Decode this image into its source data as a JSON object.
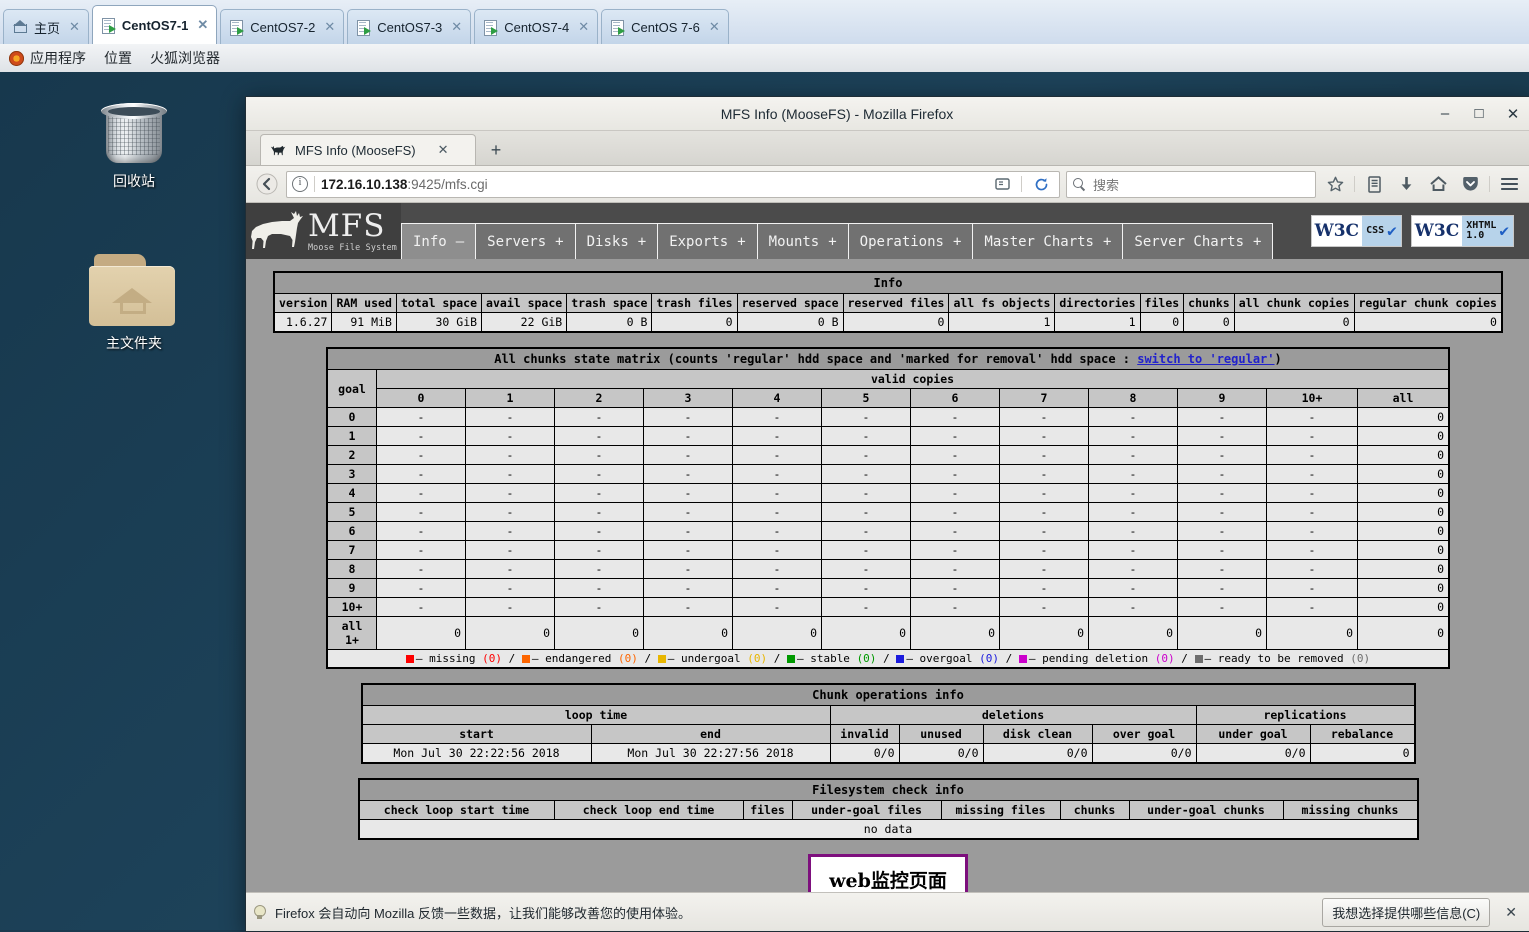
{
  "vm_tabs": [
    {
      "label": "主页",
      "icon": "home-icon",
      "active": false
    },
    {
      "label": "CentOS7-1",
      "icon": "vm-icon",
      "active": true
    },
    {
      "label": "CentOS7-2",
      "icon": "vm-icon",
      "active": false
    },
    {
      "label": "CentOS7-3",
      "icon": "vm-icon",
      "active": false
    },
    {
      "label": "CentOS7-4",
      "icon": "vm-icon",
      "active": false
    },
    {
      "label": "CentOS 7-6",
      "icon": "vm-icon",
      "active": false
    }
  ],
  "gnome_menu": [
    "应用程序",
    "位置",
    "火狐浏览器"
  ],
  "desktop_icons": [
    {
      "label": "回收站",
      "icon": "trash-icon"
    },
    {
      "label": "主文件夹",
      "icon": "home-folder-icon"
    }
  ],
  "browser": {
    "window_title": "MFS Info (MooseFS) - Mozilla Firefox",
    "minimize": "–",
    "maximize": "□",
    "close": "✕",
    "tab_title": "MFS Info (MooseFS)",
    "tab_close": "✕",
    "new_tab": "+",
    "url_host": "172.16.10.138",
    "url_rest": ":9425/mfs.cgi",
    "search_placeholder": "搜索"
  },
  "mfs": {
    "logo_title": "MFS",
    "logo_subtitle": "Moose File System",
    "nav": [
      {
        "label": "Info",
        "sign": "–",
        "selected": true
      },
      {
        "label": "Servers",
        "sign": "+",
        "selected": false
      },
      {
        "label": "Disks",
        "sign": "+",
        "selected": false
      },
      {
        "label": "Exports",
        "sign": "+",
        "selected": false
      },
      {
        "label": "Mounts",
        "sign": "+",
        "selected": false
      },
      {
        "label": "Operations",
        "sign": "+",
        "selected": false
      },
      {
        "label": "Master Charts",
        "sign": "+",
        "selected": false
      },
      {
        "label": "Server Charts",
        "sign": "+",
        "selected": false
      }
    ],
    "badges": [
      {
        "left": "W3C",
        "line1": "CSS",
        "line2": ""
      },
      {
        "left": "W3C",
        "line1": "XHTML",
        "line2": "1.0"
      }
    ],
    "info": {
      "caption": "Info",
      "headers": [
        "version",
        "RAM used",
        "total space",
        "avail space",
        "trash space",
        "trash files",
        "reserved space",
        "reserved files",
        "all fs objects",
        "directories",
        "files",
        "chunks",
        "all chunk copies",
        "regular chunk copies"
      ],
      "values": [
        "1.6.27",
        "91 MiB",
        "30 GiB",
        "22 GiB",
        "0 B",
        "0",
        "0 B",
        "0",
        "1",
        "1",
        "0",
        "0",
        "0",
        "0"
      ]
    },
    "matrix": {
      "caption_pre": "All chunks state matrix (counts 'regular' hdd space and 'marked for removal' hdd space : ",
      "caption_link": "switch to 'regular'",
      "caption_post": ")",
      "goal_label": "goal",
      "valid_copies_label": "valid copies",
      "columns": [
        "0",
        "1",
        "2",
        "3",
        "4",
        "5",
        "6",
        "7",
        "8",
        "9",
        "10+",
        "all"
      ],
      "rows": [
        {
          "goal": "0",
          "cells": [
            "-",
            "-",
            "-",
            "-",
            "-",
            "-",
            "-",
            "-",
            "-",
            "-",
            "-"
          ],
          "all": "0"
        },
        {
          "goal": "1",
          "cells": [
            "-",
            "-",
            "-",
            "-",
            "-",
            "-",
            "-",
            "-",
            "-",
            "-",
            "-"
          ],
          "all": "0"
        },
        {
          "goal": "2",
          "cells": [
            "-",
            "-",
            "-",
            "-",
            "-",
            "-",
            "-",
            "-",
            "-",
            "-",
            "-"
          ],
          "all": "0"
        },
        {
          "goal": "3",
          "cells": [
            "-",
            "-",
            "-",
            "-",
            "-",
            "-",
            "-",
            "-",
            "-",
            "-",
            "-"
          ],
          "all": "0"
        },
        {
          "goal": "4",
          "cells": [
            "-",
            "-",
            "-",
            "-",
            "-",
            "-",
            "-",
            "-",
            "-",
            "-",
            "-"
          ],
          "all": "0"
        },
        {
          "goal": "5",
          "cells": [
            "-",
            "-",
            "-",
            "-",
            "-",
            "-",
            "-",
            "-",
            "-",
            "-",
            "-"
          ],
          "all": "0"
        },
        {
          "goal": "6",
          "cells": [
            "-",
            "-",
            "-",
            "-",
            "-",
            "-",
            "-",
            "-",
            "-",
            "-",
            "-"
          ],
          "all": "0"
        },
        {
          "goal": "7",
          "cells": [
            "-",
            "-",
            "-",
            "-",
            "-",
            "-",
            "-",
            "-",
            "-",
            "-",
            "-"
          ],
          "all": "0"
        },
        {
          "goal": "8",
          "cells": [
            "-",
            "-",
            "-",
            "-",
            "-",
            "-",
            "-",
            "-",
            "-",
            "-",
            "-"
          ],
          "all": "0"
        },
        {
          "goal": "9",
          "cells": [
            "-",
            "-",
            "-",
            "-",
            "-",
            "-",
            "-",
            "-",
            "-",
            "-",
            "-"
          ],
          "all": "0"
        },
        {
          "goal": "10+",
          "cells": [
            "-",
            "-",
            "-",
            "-",
            "-",
            "-",
            "-",
            "-",
            "-",
            "-",
            "-"
          ],
          "all": "0"
        }
      ],
      "total_row": {
        "goal": "all 1+",
        "cells": [
          "0",
          "0",
          "0",
          "0",
          "0",
          "0",
          "0",
          "0",
          "0",
          "0",
          "0"
        ],
        "all": "0"
      },
      "legend": [
        {
          "color": "#fe0000",
          "label": "missing",
          "count": "(0)",
          "count_color": "#fe0000"
        },
        {
          "color": "#fd6500",
          "label": "endangered",
          "count": "(0)",
          "count_color": "#fd6500"
        },
        {
          "color": "#e8b600",
          "label": "undergoal",
          "count": "(0)",
          "count_color": "#e8b600"
        },
        {
          "color": "#009900",
          "label": "stable",
          "count": "(0)",
          "count_color": "#009900"
        },
        {
          "color": "#1b1bdd",
          "label": "overgoal",
          "count": "(0)",
          "count_color": "#1b1bdd"
        },
        {
          "color": "#cc00cc",
          "label": "pending deletion",
          "count": "(0)",
          "count_color": "#cc00cc"
        },
        {
          "color": "#6e6e6e",
          "label": "ready to be removed",
          "count": "(0)",
          "count_color": "#6e6e6e"
        }
      ],
      "legend_sep": "/"
    },
    "chunkops": {
      "caption": "Chunk operations info",
      "groups": [
        {
          "label": "loop time",
          "span": 2
        },
        {
          "label": "deletions",
          "span": 4
        },
        {
          "label": "replications",
          "span": 2
        }
      ],
      "headers": [
        "start",
        "end",
        "invalid",
        "unused",
        "disk clean",
        "over goal",
        "under goal",
        "rebalance"
      ],
      "values": [
        "Mon Jul 30 22:22:56 2018",
        "Mon Jul 30 22:27:56 2018",
        "0/0",
        "0/0",
        "0/0",
        "0/0",
        "0/0",
        "0"
      ]
    },
    "fscheck": {
      "caption": "Filesystem check info",
      "headers": [
        "check loop start time",
        "check loop end time",
        "files",
        "under-goal files",
        "missing files",
        "chunks",
        "under-goal chunks",
        "missing chunks"
      ],
      "no_data": "no data"
    }
  },
  "annotation": "web监控页面",
  "notification": {
    "message": "Firefox 会自动向 Mozilla 反馈一些数据，让我们能够改善您的使用体验。",
    "button": "我想选择提供哪些信息(C)",
    "close": "✕"
  }
}
